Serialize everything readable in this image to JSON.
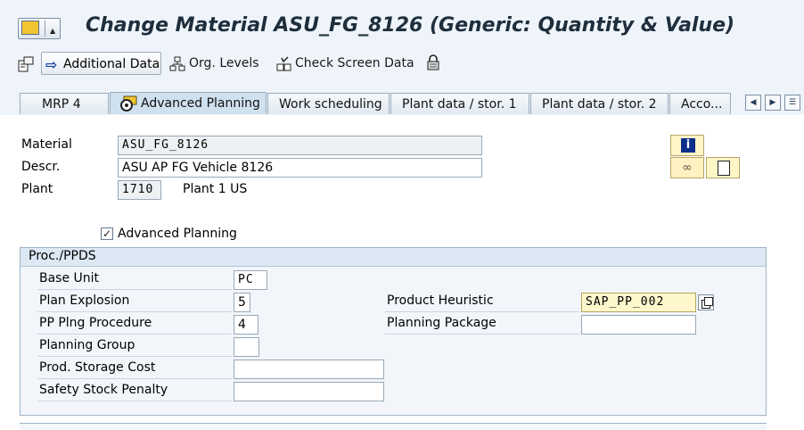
{
  "window": {
    "title": "Change Material ASU_FG_8126 (Generic: Quantity & Value)"
  },
  "toolbar": {
    "additional_data": "Additional Data",
    "org_levels": "Org. Levels",
    "check_screen_data": "Check Screen Data"
  },
  "tabs": [
    {
      "label": "MRP 4"
    },
    {
      "label": "Advanced Planning"
    },
    {
      "label": "Work scheduling"
    },
    {
      "label": "Plant data / stor. 1"
    },
    {
      "label": "Plant data / stor. 2"
    },
    {
      "label": "Acco..."
    }
  ],
  "header": {
    "material_label": "Material",
    "material_value": "ASU_FG_8126",
    "descr_label": "Descr.",
    "descr_value": "ASU AP FG Vehicle 8126",
    "plant_label": "Plant",
    "plant_value": "1710",
    "plant_name": "Plant 1 US"
  },
  "advanced_planning": {
    "label": "Advanced Planning",
    "checked": true
  },
  "group": {
    "title": "Proc./PPDS",
    "base_unit_label": "Base Unit",
    "base_unit_value": "PC",
    "plan_explosion_label": "Plan Explosion",
    "plan_explosion_value": "5",
    "pp_plng_procedure_label": "PP Plng Procedure",
    "pp_plng_procedure_value": "4",
    "planning_group_label": "Planning Group",
    "planning_group_value": "",
    "prod_storage_cost_label": "Prod. Storage Cost",
    "prod_storage_cost_value": "",
    "safety_stock_penalty_label": "Safety Stock Penalty",
    "safety_stock_penalty_value": "",
    "product_heuristic_label": "Product Heuristic",
    "product_heuristic_value": "SAP_PP_002",
    "planning_package_label": "Planning Package",
    "planning_package_value": ""
  },
  "colors": {
    "title_bar": "#eef4f9",
    "group_header": "#dce8f3",
    "highlight_field": "#fff7cc"
  }
}
